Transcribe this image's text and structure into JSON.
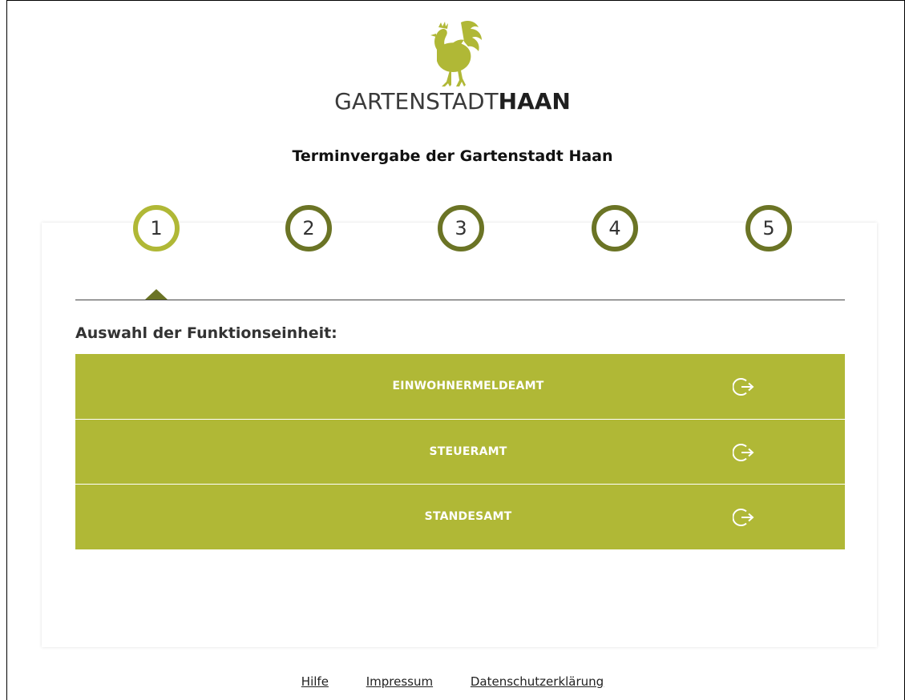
{
  "header": {
    "brand_light": "GARTENSTADT",
    "brand_bold": "HAAN",
    "app_title": "Terminvergabe der Gartenstadt Haan"
  },
  "colors": {
    "accent": "#b0b836",
    "accent_dark": "#6b7425"
  },
  "stepper": {
    "active_step": 1,
    "steps": [
      "1",
      "2",
      "3",
      "4",
      "5"
    ]
  },
  "main": {
    "section_title": "Auswahl der Funktionseinheit:",
    "options": [
      {
        "label": "EINWOHNERMELDEAMT",
        "icon": "sign-out-arrow-icon"
      },
      {
        "label": "STEUERAMT",
        "icon": "sign-out-arrow-icon"
      },
      {
        "label": "STANDESAMT",
        "icon": "sign-out-arrow-icon"
      }
    ]
  },
  "footer": {
    "links": [
      "Hilfe",
      "Impressum",
      "Datenschutzerklärung"
    ]
  }
}
